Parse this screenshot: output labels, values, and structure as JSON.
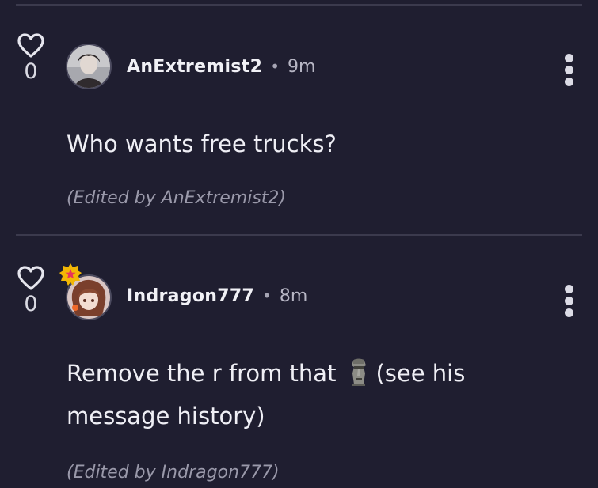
{
  "comments": [
    {
      "likes": "0",
      "username": "AnExtremist2",
      "separator": "•",
      "time": "9m",
      "body": "Who wants free trucks?",
      "edited": "(Edited by AnExtremist2)"
    },
    {
      "likes": "0",
      "username": "Indragon777",
      "separator": "•",
      "time": "8m",
      "body_before_emoji": "Remove the r from that",
      "emoji": "moai-emoji",
      "body_after_emoji": "(see his",
      "body_line2": "message history)",
      "edited": "(Edited by Indragon777)"
    }
  ],
  "colors": {
    "background": "#1f1e30",
    "divider": "#3b3a4d",
    "text": "#efeff5",
    "muted": "#9a99aa",
    "badge": "#f2b705",
    "badge_star": "#e8325a"
  },
  "icons": {
    "like": "heart-outline-icon",
    "menu": "more-vertical-icon",
    "badge": "star-badge-icon"
  }
}
